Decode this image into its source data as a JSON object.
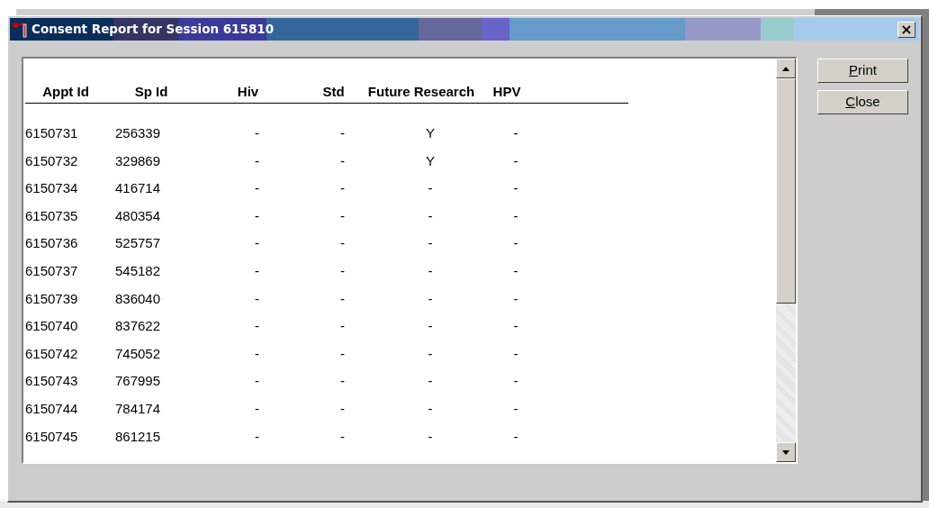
{
  "window": {
    "title": "Consent Report for Session 615810",
    "close_glyph": "×"
  },
  "table": {
    "columns": [
      "Appt Id",
      "Sp Id",
      "Hiv",
      "Std",
      "Future Research",
      "HPV"
    ],
    "rows": [
      [
        "6150731",
        "256339",
        "-",
        "-",
        "Y",
        "-"
      ],
      [
        "6150732",
        "329869",
        "-",
        "-",
        "Y",
        "-"
      ],
      [
        "6150734",
        "416714",
        "-",
        "-",
        "-",
        "-"
      ],
      [
        "6150735",
        "480354",
        "-",
        "-",
        "-",
        "-"
      ],
      [
        "6150736",
        "525757",
        "-",
        "-",
        "-",
        "-"
      ],
      [
        "6150737",
        "545182",
        "-",
        "-",
        "-",
        "-"
      ],
      [
        "6150739",
        "836040",
        "-",
        "-",
        "-",
        "-"
      ],
      [
        "6150740",
        "837622",
        "-",
        "-",
        "-",
        "-"
      ],
      [
        "6150742",
        "745052",
        "-",
        "-",
        "-",
        "-"
      ],
      [
        "6150743",
        "767995",
        "-",
        "-",
        "-",
        "-"
      ],
      [
        "6150744",
        "784174",
        "-",
        "-",
        "-",
        "-"
      ],
      [
        "6150745",
        "861215",
        "-",
        "-",
        "-",
        "-"
      ]
    ]
  },
  "buttons": [
    "Print",
    "Close"
  ]
}
